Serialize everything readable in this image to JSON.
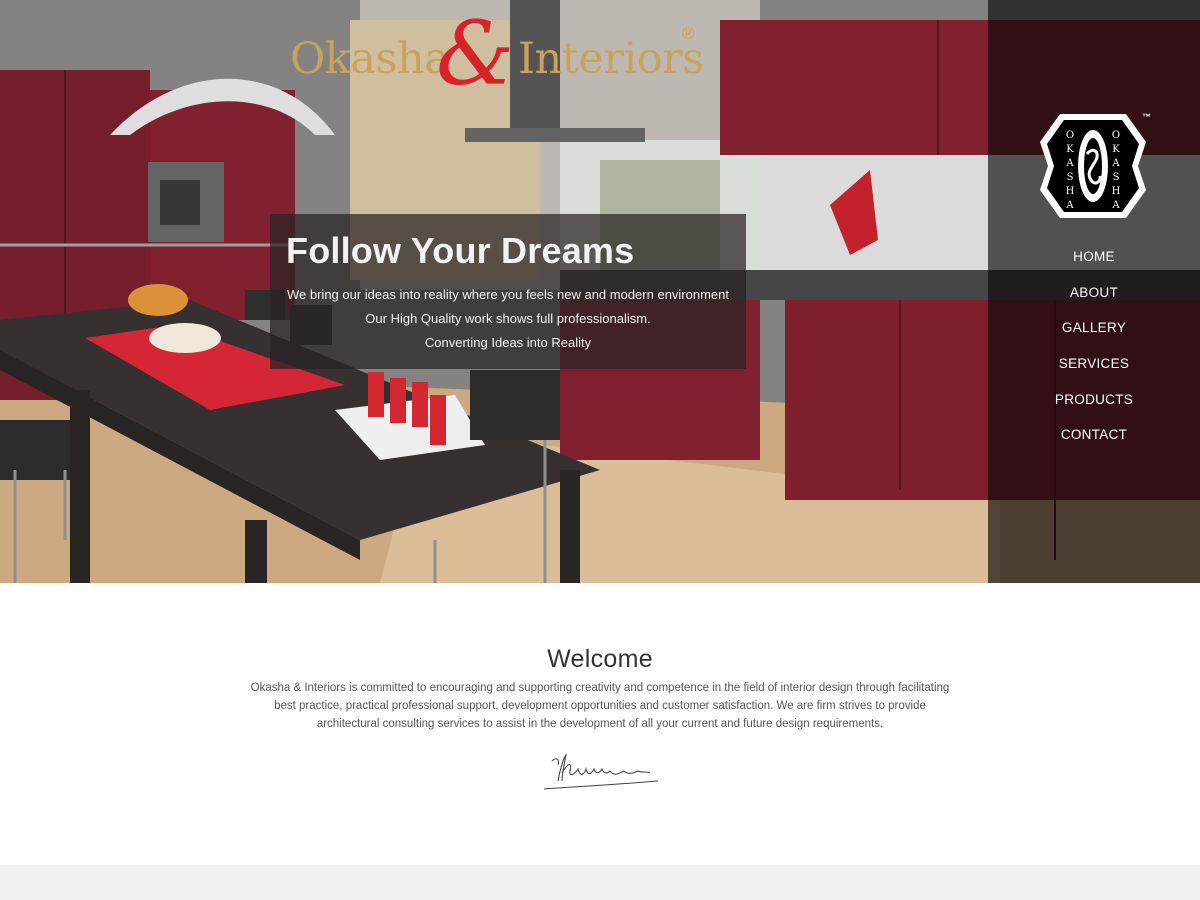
{
  "brand": {
    "name_left": "Okasha",
    "ampersand": "&",
    "name_right": "Interiors",
    "registered": "®",
    "logo_text": "OKASHA",
    "logo_tm": "™"
  },
  "hero": {
    "title": "Follow Your Dreams",
    "lines": [
      "We bring our ideas into reality where you feels new and modern environment",
      "Our High Quality work shows full professionalism.",
      "Converting Ideas into Reality"
    ]
  },
  "nav": {
    "items": [
      "HOME",
      "ABOUT",
      "GALLERY",
      "SERVICES",
      "PRODUCTS",
      "CONTACT"
    ]
  },
  "welcome": {
    "heading": "Welcome",
    "body": "Okasha & Interiors is committed to encouraging and supporting creativity and competence in the field of interior design through facilitating best practice, practical professional support, development opportunities and customer satisfaction. We are firm strives to provide architectural consulting services to assist in the development of all your current and future design requirements."
  },
  "colors": {
    "brand_gold": "#c9a35c",
    "brand_red": "#d6232a",
    "cabinet_red": "#7a1322"
  }
}
